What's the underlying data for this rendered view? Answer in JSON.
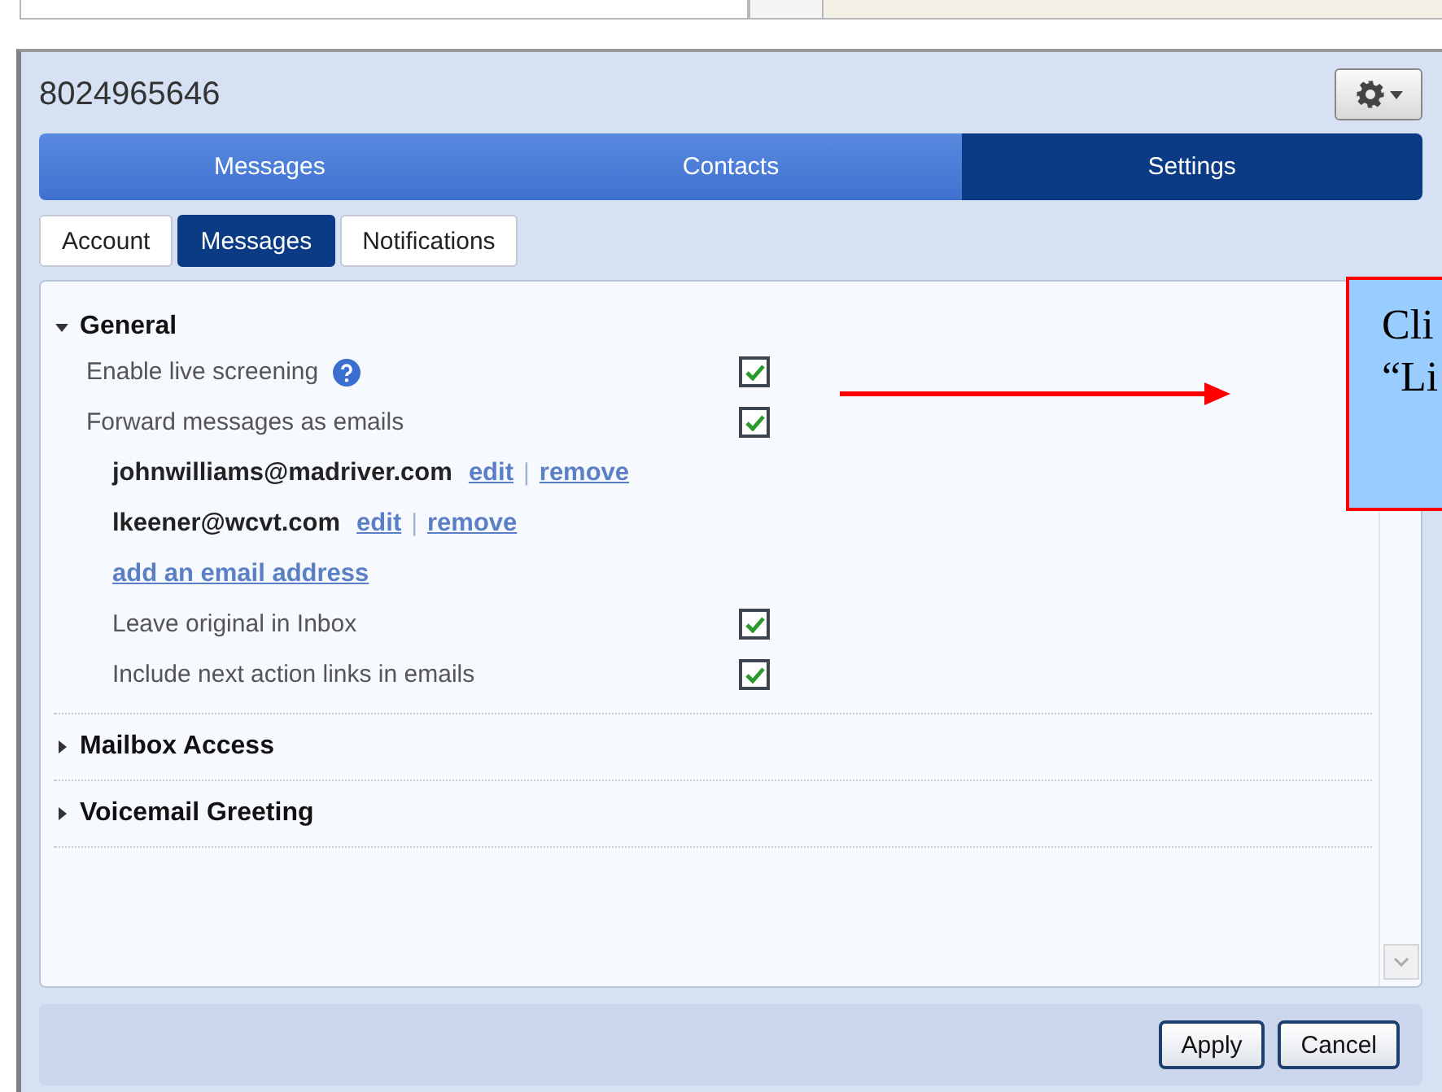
{
  "window": {
    "title": "8024965646"
  },
  "nav_tabs": [
    {
      "label": "Messages",
      "selected": false
    },
    {
      "label": "Contacts",
      "selected": false
    },
    {
      "label": "Settings",
      "selected": true
    }
  ],
  "sub_tabs": [
    {
      "label": "Account",
      "selected": false
    },
    {
      "label": "Messages",
      "selected": true
    },
    {
      "label": "Notifications",
      "selected": false
    }
  ],
  "sections": [
    {
      "title": "General",
      "expanded": true,
      "items": [
        {
          "kind": "checkbox",
          "label": "Enable live screening",
          "help": true,
          "checked": true,
          "indented": false
        },
        {
          "kind": "checkbox",
          "label": "Forward messages as emails",
          "checked": true,
          "indented": false
        },
        {
          "kind": "email",
          "address": "johnwilliams@madriver.com",
          "actions": [
            "edit",
            "remove"
          ],
          "separator": "|"
        },
        {
          "kind": "email",
          "address": "lkeener@wcvt.com",
          "actions": [
            "edit",
            "remove"
          ],
          "separator": "|"
        },
        {
          "kind": "link",
          "label": "add an email address"
        },
        {
          "kind": "checkbox",
          "label": "Leave original in Inbox",
          "checked": true,
          "indented": true
        },
        {
          "kind": "checkbox",
          "label": "Include next action links in emails",
          "checked": true,
          "indented": true
        }
      ]
    },
    {
      "title": "Mailbox Access",
      "expanded": false
    },
    {
      "title": "Voicemail Greeting",
      "expanded": false
    }
  ],
  "buttons": [
    "Apply",
    "Cancel"
  ],
  "callout": {
    "lines": [
      "Cli",
      "“Li"
    ]
  }
}
